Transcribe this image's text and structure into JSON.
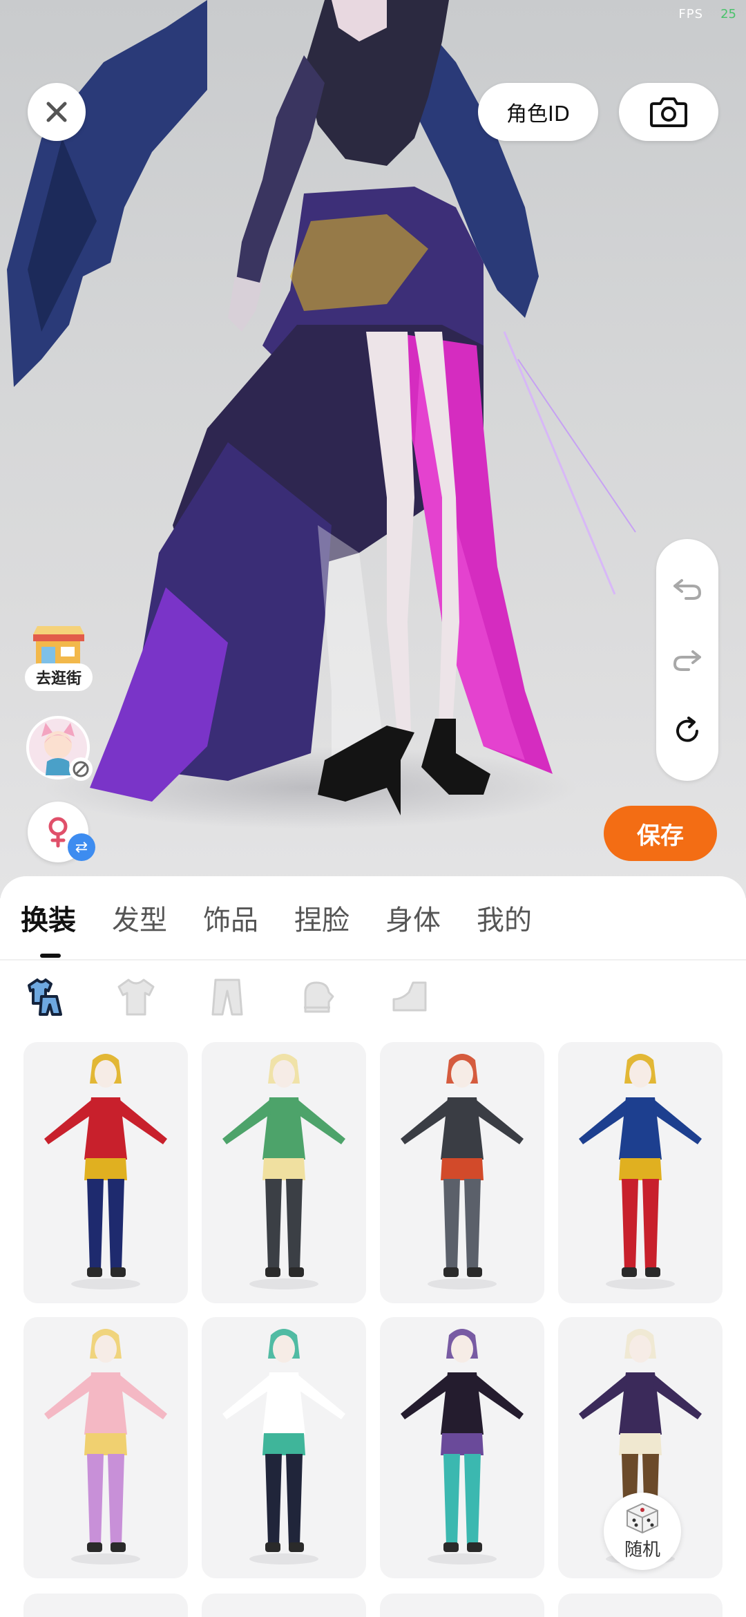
{
  "status": {
    "fps_label": "FPS",
    "fps_value": "25"
  },
  "top_bar": {
    "role_id_label": "角色ID"
  },
  "left_tools": {
    "shop_label": "去逛街"
  },
  "save_label": "保存",
  "tabs": [
    {
      "label": "换装",
      "active": true
    },
    {
      "label": "发型",
      "active": false
    },
    {
      "label": "饰品",
      "active": false
    },
    {
      "label": "捏脸",
      "active": false
    },
    {
      "label": "身体",
      "active": false
    },
    {
      "label": "我的",
      "active": false
    }
  ],
  "subcategories": [
    "outfit-set-icon",
    "top-shirt-icon",
    "pants-icon",
    "gloves-icon",
    "shoes-icon"
  ],
  "outfits": [
    {
      "name": "hero-red-gold-outfit",
      "colors": [
        "#c8202c",
        "#1e2a6e",
        "#e0b020"
      ]
    },
    {
      "name": "green-kimono-outfit",
      "colors": [
        "#4da36a",
        "#3b3f45",
        "#f0e0a0"
      ]
    },
    {
      "name": "black-combat-outfit",
      "colors": [
        "#3a3d44",
        "#5b606a",
        "#d24a2a"
      ]
    },
    {
      "name": "blue-red-hero-outfit",
      "colors": [
        "#1d3f8f",
        "#c8202c",
        "#e0b020"
      ]
    },
    {
      "name": "pink-cat-costume",
      "colors": [
        "#f4b8c4",
        "#c890d8",
        "#f0d070"
      ]
    },
    {
      "name": "track-suit-outfit",
      "colors": [
        "#ffffff",
        "#20253a",
        "#3fb59a"
      ]
    },
    {
      "name": "dark-gothic-dress",
      "colors": [
        "#241c2e",
        "#3bb8b0",
        "#6a4a9a"
      ]
    },
    {
      "name": "purple-academy-robe",
      "colors": [
        "#3b2a5a",
        "#6b4a2a",
        "#f0e8d0"
      ]
    }
  ],
  "random_label": "随机"
}
